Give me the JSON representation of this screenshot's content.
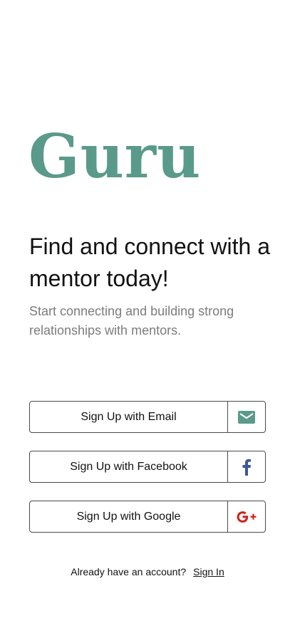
{
  "brand": {
    "name": "Guru",
    "color": "#5a9a8a"
  },
  "hero": {
    "headline": "Find and connect with a mentor today!",
    "subtext": "Start connecting and building strong relationships with mentors."
  },
  "signup": {
    "email": {
      "label": "Sign Up with Email",
      "icon": "envelope-icon",
      "icon_color": "#5a9a8a"
    },
    "facebook": {
      "label": "Sign Up with Facebook",
      "icon": "facebook-icon",
      "icon_color": "#3b5998"
    },
    "google": {
      "label": "Sign Up with Google",
      "icon": "google-plus-icon",
      "icon_color": "#d0201c"
    }
  },
  "signin": {
    "prompt": "Already have an account?",
    "link": "Sign In"
  }
}
